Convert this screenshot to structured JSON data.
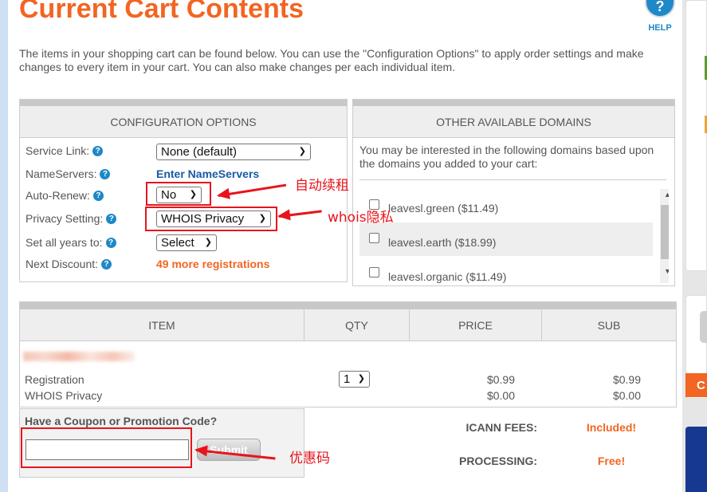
{
  "page": {
    "title": "Current Cart Contents",
    "help_label": "HELP",
    "help_glyph": "?",
    "intro": "The items in your shopping cart can be found below. You can use the \"Configuration Options\" to apply order settings and make changes to every item in your cart. You can also make changes per each individual item."
  },
  "config": {
    "heading": "CONFIGURATION OPTIONS",
    "service_link_label": "Service Link:",
    "service_link_value": "None (default)",
    "nameservers_label": "NameServers:",
    "nameservers_link": "Enter NameServers",
    "auto_renew_label": "Auto-Renew:",
    "auto_renew_value": "No",
    "privacy_label": "Privacy Setting:",
    "privacy_value": "WHOIS Privacy",
    "years_label": "Set all years to:",
    "years_value": "Select",
    "discount_label": "Next Discount:",
    "discount_value": "49 more registrations"
  },
  "domains": {
    "heading": "OTHER AVAILABLE DOMAINS",
    "intro": "You may be interested in the following domains based upon the domains you added to your cart:",
    "items": [
      {
        "label": "leavesl.green ($11.49)",
        "checked": false
      },
      {
        "label": "leavesl.earth ($18.99)",
        "checked": false
      },
      {
        "label": "leavesl.organic ($11.49)",
        "checked": false
      }
    ]
  },
  "items_table": {
    "headers": [
      "ITEM",
      "QTY",
      "PRICE",
      "SUB"
    ],
    "rows": [
      {
        "item": "Registration",
        "qty": "1",
        "price": "$0.99",
        "sub": "$0.99"
      },
      {
        "item": "WHOIS Privacy",
        "price": "$0.00",
        "sub": "$0.00"
      }
    ]
  },
  "coupon": {
    "label": "Have a Coupon or Promotion Code?",
    "input_value": "",
    "submit_label": "Submit"
  },
  "fees": {
    "icann_label": "ICANN FEES:",
    "icann_value": "Included!",
    "processing_label": "PROCESSING:",
    "processing_value": "Free!"
  },
  "annotations": {
    "auto_renew_note": "自动续租",
    "privacy_note": "whois隐私",
    "coupon_note": "优惠码"
  },
  "sidebar": {
    "orange_badge": "C"
  },
  "colors": {
    "accent_orange": "#f26522",
    "link_blue": "#1a5aa6",
    "annotation_red": "#e8141b"
  }
}
